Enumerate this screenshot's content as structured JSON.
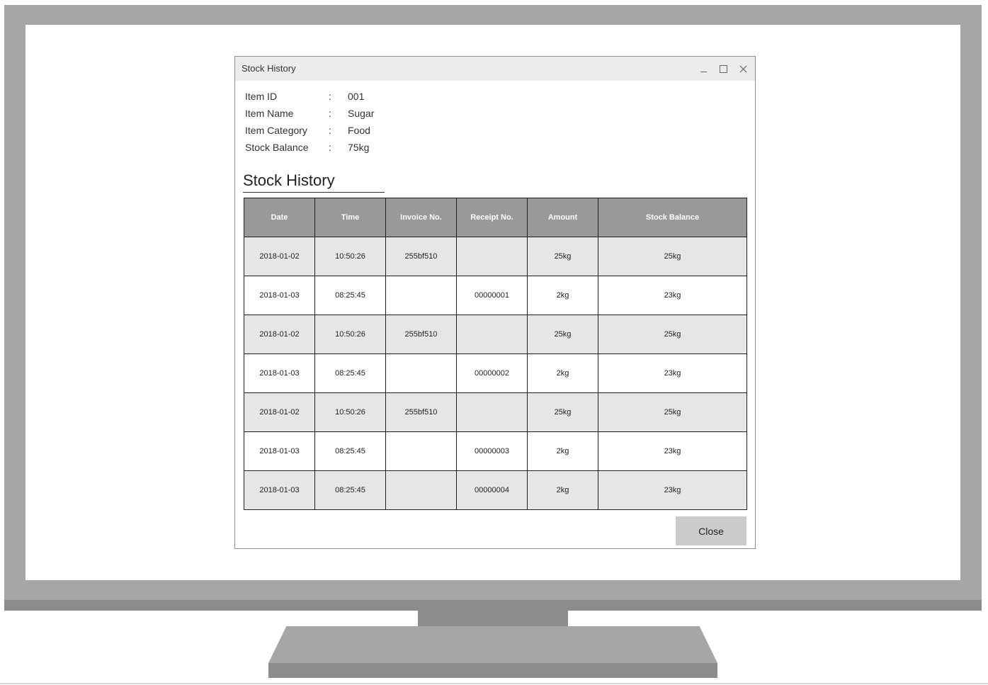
{
  "window": {
    "title": "Stock History",
    "controls": {
      "minimize": "_",
      "close": "×"
    }
  },
  "item_info": [
    {
      "label": "Item ID",
      "separator": ":",
      "value": "001"
    },
    {
      "label": "Item Name",
      "separator": ":",
      "value": "Sugar"
    },
    {
      "label": "Item Category",
      "separator": ":",
      "value": "Food"
    },
    {
      "label": "Stock Balance",
      "separator": ":",
      "value": "75kg"
    }
  ],
  "section": {
    "title": "Stock History"
  },
  "table": {
    "headers": [
      "Date",
      "Time",
      "Invoice No.",
      "Receipt No.",
      "Amount",
      "Stock Balance"
    ],
    "rows": [
      [
        "2018-01-02",
        "10:50:26",
        "255bf510",
        "",
        "25kg",
        "25kg"
      ],
      [
        "2018-01-03",
        "08:25:45",
        "",
        "00000001",
        "2kg",
        "23kg"
      ],
      [
        "2018-01-02",
        "10:50:26",
        "255bf510",
        "",
        "25kg",
        "25kg"
      ],
      [
        "2018-01-03",
        "08:25:45",
        "",
        "00000002",
        "2kg",
        "23kg"
      ],
      [
        "2018-01-02",
        "10:50:26",
        "255bf510",
        "",
        "25kg",
        "25kg"
      ],
      [
        "2018-01-03",
        "08:25:45",
        "",
        "00000003",
        "2kg",
        "23kg"
      ],
      [
        "2018-01-03",
        "08:25:45",
        "",
        "00000004",
        "2kg",
        "23kg"
      ]
    ]
  },
  "buttons": {
    "close_label": "Close"
  },
  "colors": {
    "header_fill": "#999999",
    "shaded_row": "#e6e6e6",
    "titlebar": "#ececec",
    "button": "#cccccc"
  }
}
